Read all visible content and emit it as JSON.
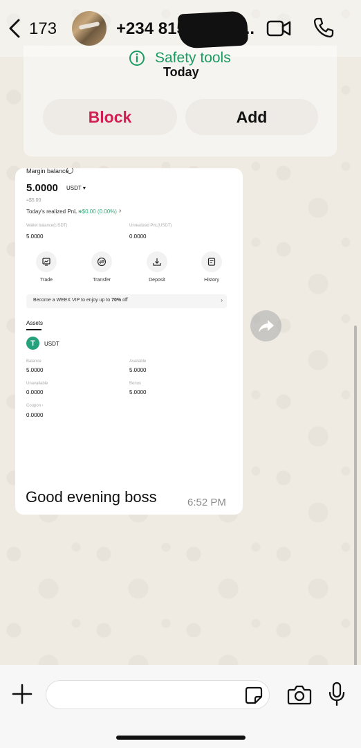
{
  "header": {
    "back_count": "173",
    "contact_name": "+234 815",
    "name_ellipsis": "..."
  },
  "safety": {
    "label": "Safety tools",
    "today": "Today",
    "block_label": "Block",
    "add_label": "Add"
  },
  "screenshot": {
    "heading": "Margin balance",
    "balance": "5.0000",
    "unit": "USDT ▾",
    "approx": "≈$5.00",
    "pnl_label": "Today's realized PnL ≈",
    "pnl_value": "+$0.00 (0.00%)",
    "pnl_arrow": "›",
    "wallet_label": "Wallet balance(USDT)",
    "wallet_value": "5.0000",
    "unrealized_label": "Unrealized PnL(USDT)",
    "unrealized_value": "0.0000",
    "actions": [
      {
        "label": "Trade"
      },
      {
        "label": "Transfer"
      },
      {
        "label": "Deposit"
      },
      {
        "label": "History"
      }
    ],
    "vip_prefix": "Become a WEEX VIP to enjoy up to ",
    "vip_percent": "70%",
    "vip_suffix": " off",
    "vip_arrow": "›",
    "assets_label": "Assets",
    "usdt_icon": "T",
    "usdt_name": "USDT",
    "balance_label": "Balance",
    "balance_value": "5.0000",
    "available_label": "Available",
    "available_value": "5.0000",
    "unavailable_label": "Unavailable",
    "unavailable_value": "0.0000",
    "bonus_label": "Bonus",
    "bonus_value": "5.0000",
    "coupon_label": "Coupon ›",
    "coupon_value": "0.0000"
  },
  "message": {
    "text": "Good evening boss",
    "time": "6:52 PM"
  },
  "composer": {
    "placeholder": ""
  },
  "colors": {
    "safety_green": "#1a9b62",
    "block_red": "#d21f53",
    "pnl_green": "#2bb07a",
    "usdt_green": "#26a17b"
  }
}
